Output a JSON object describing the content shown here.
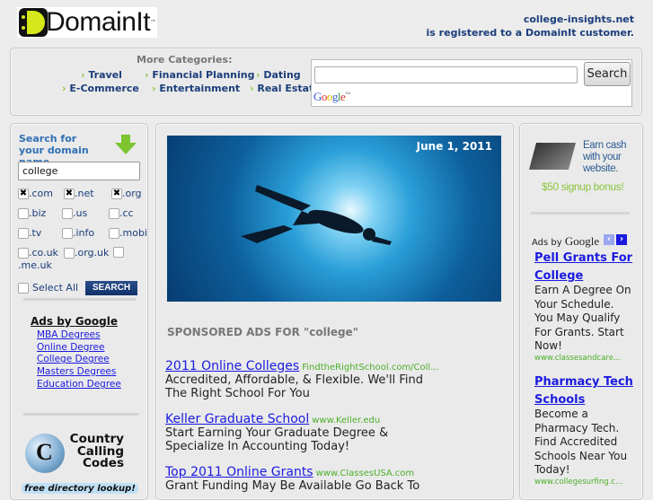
{
  "header": {
    "logo_text": "DomainIt",
    "logo_tm": "™",
    "domain": "college-insights.net",
    "registered_text": "is registered to a DomainIt customer."
  },
  "categories": {
    "title": "More Categories:",
    "items": [
      "Travel",
      "Financial Planning",
      "Dating",
      "E-Commerce",
      "Entertainment",
      "Real Estate"
    ]
  },
  "google_search": {
    "query": "",
    "button": "Search",
    "logo": "Google",
    "tm": "™"
  },
  "domain_search": {
    "title": "Search for your domain name",
    "value": "college",
    "tlds": [
      {
        "label": ".com",
        "checked": true
      },
      {
        "label": ".net",
        "checked": true
      },
      {
        "label": ".org",
        "checked": true
      },
      {
        "label": ".biz",
        "checked": false
      },
      {
        "label": ".us",
        "checked": false
      },
      {
        "label": ".cc",
        "checked": false
      },
      {
        "label": ".tv",
        "checked": false
      },
      {
        "label": ".info",
        "checked": false
      },
      {
        "label": ".mobi",
        "checked": false
      },
      {
        "label": ".co.uk",
        "checked": false
      },
      {
        "label": ".org.uk",
        "checked": false
      },
      {
        "label": ".me.uk",
        "checked": false
      }
    ],
    "select_all": "Select All",
    "search_button": "SEARCH"
  },
  "left_ads": {
    "title": "Ads by Google",
    "links": [
      "MBA Degrees",
      "Online Degree",
      "College Degree",
      "Masters Degrees",
      "Education Degree"
    ]
  },
  "calling_codes": {
    "line1": "Country",
    "line2": "Calling",
    "line3": "Codes",
    "tagline": "free directory lookup!"
  },
  "hero": {
    "date": "June 1, 2011"
  },
  "sponsored": {
    "title": "SPONSORED ADS FOR \"college\"",
    "ads": [
      {
        "title": "2011 Online Colleges",
        "url": "FindtheRightSchool.com/Coll...",
        "desc": "Accredited, Affordable, & Flexible. We'll Find The Right School For You"
      },
      {
        "title": "Keller Graduate School",
        "url": "www.Keller.edu",
        "desc": "Start Earning Your Graduate Degree & Specialize In Accounting Today!"
      },
      {
        "title": "Top 2011 Online Grants",
        "url": "www.ClassesUSA.com",
        "desc": "Grant Funding May Be Available Go Back To"
      }
    ]
  },
  "right": {
    "earn1": "Earn cash",
    "earn2": "with your",
    "earn3": "website.",
    "bonus": "$50 signup bonus!",
    "ads_by": "Ads by",
    "google": "Google",
    "ads": [
      {
        "title": "Pell Grants For College",
        "desc": "Earn A Degree On Your Schedule. You May Qualify For Grants. Start Now!",
        "url": "www.classesandcare..."
      },
      {
        "title": "Pharmacy Tech Schools",
        "desc": "Become a Pharmacy Tech. Find Accredited Schools Near You Today!",
        "url": "www.collegesurfing.c..."
      }
    ]
  }
}
